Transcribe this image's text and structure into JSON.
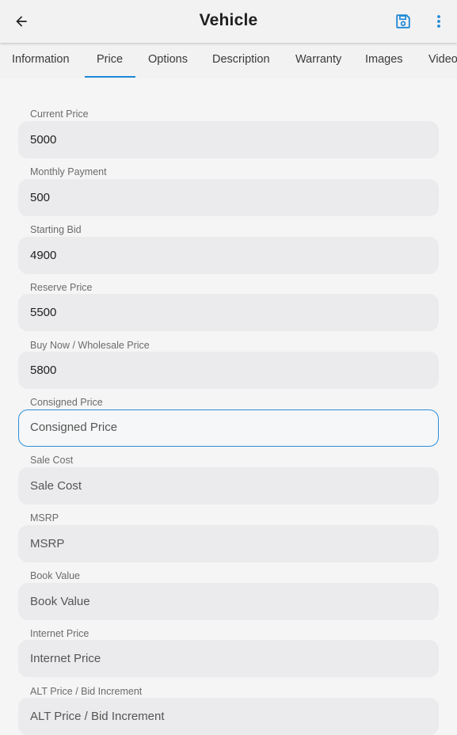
{
  "app_bar": {
    "title": "Vehicle",
    "back_icon": "arrow-left-icon",
    "save_icon": "floppy-disk-icon",
    "more_icon": "more-vertical-icon",
    "accent_color": "#1e88d6"
  },
  "tabs": [
    {
      "label": "Information",
      "selected": false
    },
    {
      "label": "Price",
      "selected": true
    },
    {
      "label": "Options",
      "selected": false
    },
    {
      "label": "Description",
      "selected": false
    },
    {
      "label": "Warranty",
      "selected": false
    },
    {
      "label": "Images",
      "selected": false
    },
    {
      "label": "Video",
      "selected": false
    }
  ],
  "fields": [
    {
      "label": "Current Price",
      "value": "5000",
      "placeholder": ""
    },
    {
      "label": "Monthly Payment",
      "value": "500",
      "placeholder": ""
    },
    {
      "label": "Starting Bid",
      "value": "4900",
      "placeholder": ""
    },
    {
      "label": "Reserve Price",
      "value": "5500",
      "placeholder": ""
    },
    {
      "label": "Buy Now / Wholesale Price",
      "value": "5800",
      "placeholder": ""
    },
    {
      "label": "Consigned Price",
      "value": "",
      "placeholder": "Consigned Price",
      "focused": true
    },
    {
      "label": "Sale Cost",
      "value": "",
      "placeholder": "Sale Cost"
    },
    {
      "label": "MSRP",
      "value": "",
      "placeholder": "MSRP"
    },
    {
      "label": "Book Value",
      "value": "",
      "placeholder": "Book Value"
    },
    {
      "label": "Internet Price",
      "value": "",
      "placeholder": "Internet Price"
    },
    {
      "label": "ALT Price / Bid Increment",
      "value": "",
      "placeholder": "ALT Price / Bid Increment"
    }
  ]
}
